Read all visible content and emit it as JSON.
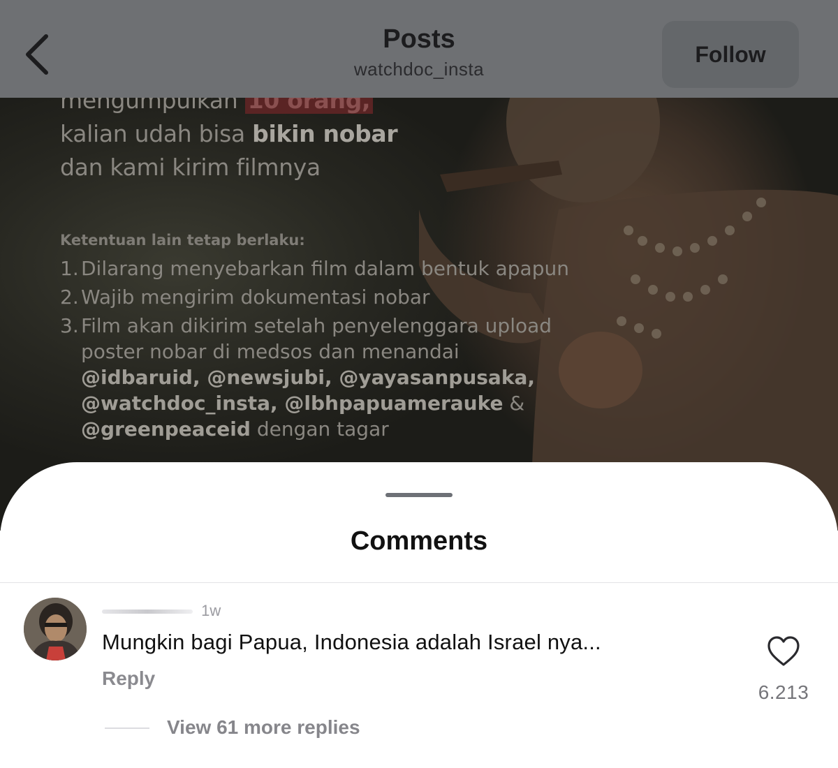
{
  "header": {
    "title": "Posts",
    "username": "watchdoc_insta",
    "follow_label": "Follow"
  },
  "post_image": {
    "headline_lead": "mengumpulkan",
    "headline_highlight": "10 orang,",
    "headline_line2_pre": "kalian udah bisa",
    "headline_line2_bold": "bikin nobar",
    "headline_line3": "dan kami kirim filmnya",
    "rules_title": "Ketentuan lain tetap berlaku:",
    "rules": [
      {
        "num": "1.",
        "text": "Dilarang menyebarkan film dalam bentuk apapun",
        "bold": ""
      },
      {
        "num": "2.",
        "text": "Wajib mengirim dokumentasi nobar",
        "bold": ""
      },
      {
        "num": "3.",
        "text": "Film akan dikirim setelah penyelenggara upload poster nobar di medsos dan menandai",
        "bold": "@idbaruid, @newsjubi, @yayasanpusaka, @watchdoc_insta, @lbhpapuamerauke",
        "tail_amp": "&",
        "bold2": "@greenpeaceid",
        "tail": "dengan tagar"
      }
    ]
  },
  "comments": {
    "sheet_title": "Comments",
    "items": [
      {
        "time": "1w",
        "text": "Mungkin bagi Papua, Indonesia adalah Israel nya...",
        "reply_label": "Reply",
        "likes": "6.213",
        "view_replies_label": "View 61 more replies"
      }
    ]
  },
  "colors": {
    "header_bg": "#6e7073",
    "follow_bg": "#64676a",
    "sheet_bg": "#ffffff",
    "secondary_text": "#8a8a8f"
  },
  "icons": {
    "back": "chevron-left-icon",
    "like": "heart-outline-icon"
  }
}
